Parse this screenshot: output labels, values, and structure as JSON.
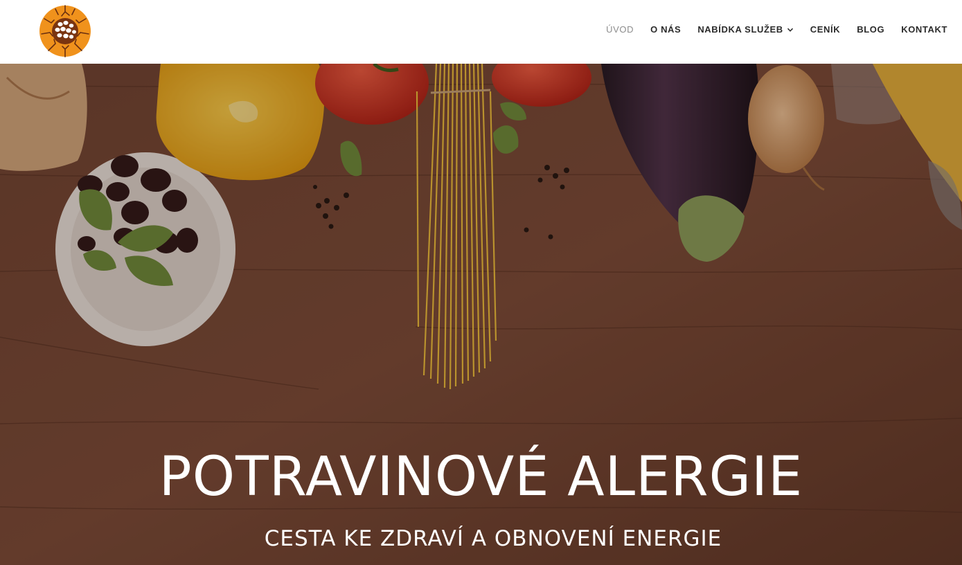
{
  "header": {
    "logo_icon": "circular-orange-logo-icon",
    "nav": [
      {
        "label": "ÚVOD",
        "active": true
      },
      {
        "label": "O NÁS",
        "active": false
      },
      {
        "label": "NABÍDKA SLUŽEB",
        "active": false,
        "dropdown": true
      },
      {
        "label": "CENÍK",
        "active": false
      },
      {
        "label": "BLOG",
        "active": false
      },
      {
        "label": "KONTAKT",
        "active": false
      }
    ]
  },
  "hero": {
    "title": "POTRAVINOVÉ ALERGIE",
    "subtitle": "CESTA KE ZDRAVÍ A OBNOVENÍ ENERGIE"
  },
  "colors": {
    "logo_orange": "#f0921c",
    "nav_active": "#8c8c8c",
    "nav_text": "#2b2b2b",
    "hero_wood": "#6b4030"
  }
}
